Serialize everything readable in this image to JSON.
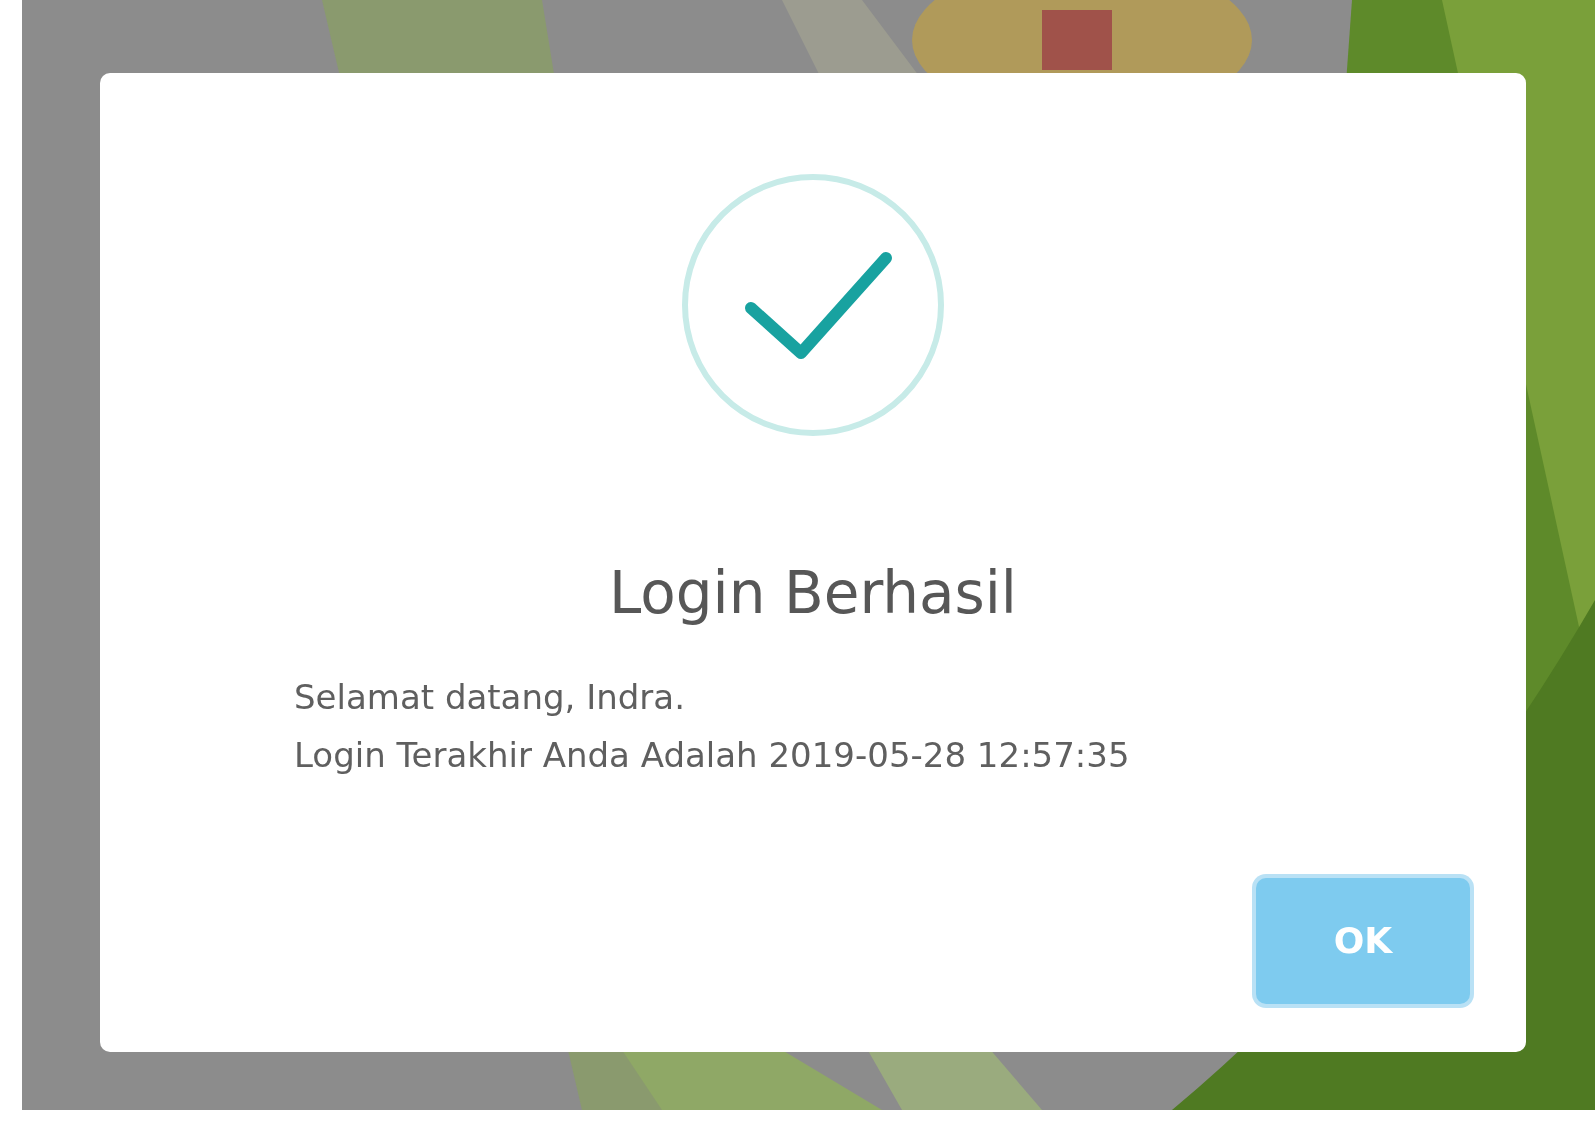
{
  "dialog": {
    "title": "Login Berhasil",
    "message_lines": [
      "Selamat datang, Indra.",
      "Login Terakhir Anda Adalah 2019-05-28 12:57:35"
    ],
    "buttons": [
      {
        "label": "OK",
        "focused": true
      }
    ]
  }
}
